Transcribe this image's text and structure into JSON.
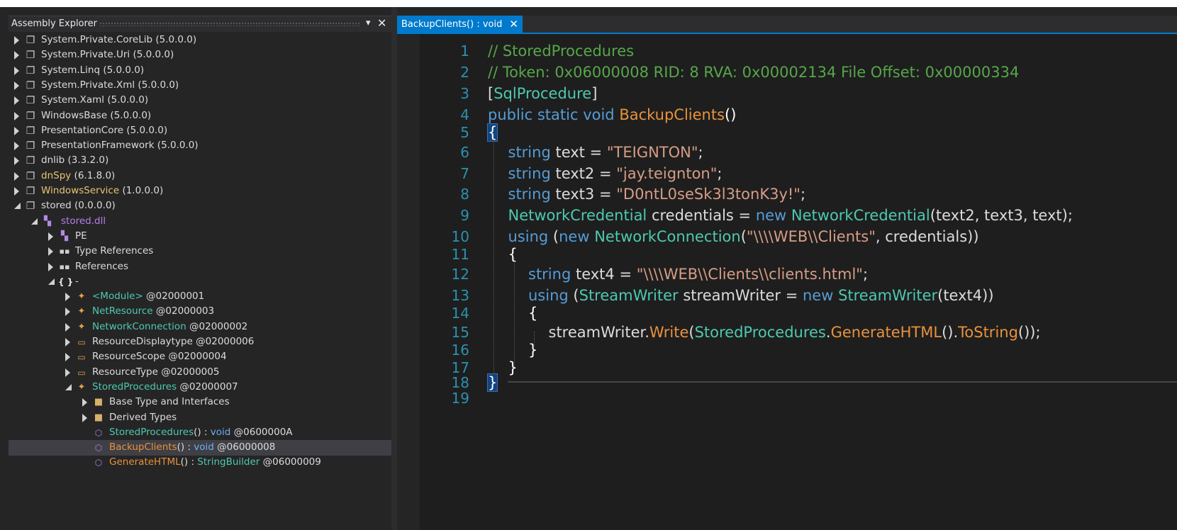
{
  "explorer": {
    "title": "Assembly Explorer",
    "pin_icon": "dropdown-arrow-icon",
    "close_icon": "close-icon",
    "pin_glyph": "▾",
    "close_glyph": "✕",
    "nodes": [
      {
        "parts": [
          {
            "t": "System.Private.CoreLib",
            "c": "white"
          },
          {
            "t": " (5.0.0.0)",
            "c": "white"
          }
        ],
        "icon": "assembly-icon",
        "state": "collapsed"
      },
      {
        "parts": [
          {
            "t": "System.Private.Uri",
            "c": "white"
          },
          {
            "t": " (5.0.0.0)",
            "c": "white"
          }
        ],
        "icon": "assembly-icon",
        "state": "collapsed"
      },
      {
        "parts": [
          {
            "t": "System.Linq",
            "c": "white"
          },
          {
            "t": " (5.0.0.0)",
            "c": "white"
          }
        ],
        "icon": "assembly-icon",
        "state": "collapsed"
      },
      {
        "parts": [
          {
            "t": "System.Private.Xml",
            "c": "white"
          },
          {
            "t": " (5.0.0.0)",
            "c": "white"
          }
        ],
        "icon": "assembly-icon",
        "state": "collapsed"
      },
      {
        "parts": [
          {
            "t": "System.Xaml",
            "c": "white"
          },
          {
            "t": " (5.0.0.0)",
            "c": "white"
          }
        ],
        "icon": "assembly-icon",
        "state": "collapsed"
      },
      {
        "parts": [
          {
            "t": "WindowsBase",
            "c": "white"
          },
          {
            "t": " (5.0.0.0)",
            "c": "white"
          }
        ],
        "icon": "assembly-icon",
        "state": "collapsed"
      },
      {
        "parts": [
          {
            "t": "PresentationCore",
            "c": "white"
          },
          {
            "t": " (5.0.0.0)",
            "c": "white"
          }
        ],
        "icon": "assembly-icon",
        "state": "collapsed"
      },
      {
        "parts": [
          {
            "t": "PresentationFramework",
            "c": "white"
          },
          {
            "t": " (5.0.0.0)",
            "c": "white"
          }
        ],
        "icon": "assembly-icon",
        "state": "collapsed"
      },
      {
        "parts": [
          {
            "t": "dnlib",
            "c": "white"
          },
          {
            "t": " (3.3.2.0)",
            "c": "white"
          }
        ],
        "icon": "assembly-icon",
        "state": "collapsed"
      },
      {
        "parts": [
          {
            "t": "dnSpy",
            "c": "yellow"
          },
          {
            "t": " (6.1.8.0)",
            "c": "white"
          }
        ],
        "icon": "assembly-icon-yellow",
        "state": "collapsed"
      },
      {
        "parts": [
          {
            "t": "WindowsService",
            "c": "yellow"
          },
          {
            "t": " (1.0.0.0)",
            "c": "white"
          }
        ],
        "icon": "assembly-icon-yellow",
        "state": "collapsed"
      },
      {
        "parts": [
          {
            "t": "stored",
            "c": "white"
          },
          {
            "t": " (0.0.0.0)",
            "c": "white"
          }
        ],
        "icon": "assembly-icon",
        "state": "expanded"
      },
      {
        "parts": [
          {
            "t": "stored.dll",
            "c": "purple"
          }
        ],
        "icon": "module-icon",
        "state": "expanded"
      },
      {
        "parts": [
          {
            "t": "PE",
            "c": "white"
          }
        ],
        "icon": "pe-icon",
        "state": "collapsed"
      },
      {
        "parts": [
          {
            "t": "Type References",
            "c": "white"
          }
        ],
        "icon": "references-icon",
        "state": "collapsed"
      },
      {
        "parts": [
          {
            "t": "References",
            "c": "white"
          }
        ],
        "icon": "references-icon",
        "state": "collapsed"
      },
      {
        "parts": [
          {
            "t": "-",
            "c": "white"
          }
        ],
        "icon": "namespace-icon",
        "state": "expanded"
      },
      {
        "parts": [
          {
            "t": "<Module>",
            "c": "teal"
          },
          {
            "t": " @02000001",
            "c": "white"
          }
        ],
        "icon": "class-icon",
        "state": "collapsed"
      },
      {
        "parts": [
          {
            "t": "NetResource",
            "c": "teal"
          },
          {
            "t": " @02000003",
            "c": "white"
          }
        ],
        "icon": "class-icon",
        "state": "collapsed"
      },
      {
        "parts": [
          {
            "t": "NetworkConnection",
            "c": "teal"
          },
          {
            "t": " @02000002",
            "c": "white"
          }
        ],
        "icon": "class-icon",
        "state": "collapsed"
      },
      {
        "parts": [
          {
            "t": "ResourceDisplaytype",
            "c": "white"
          },
          {
            "t": " @02000006",
            "c": "white"
          }
        ],
        "icon": "enum-icon",
        "state": "collapsed"
      },
      {
        "parts": [
          {
            "t": "ResourceScope",
            "c": "white"
          },
          {
            "t": " @02000004",
            "c": "white"
          }
        ],
        "icon": "enum-icon",
        "state": "collapsed"
      },
      {
        "parts": [
          {
            "t": "ResourceType",
            "c": "white"
          },
          {
            "t": " @02000005",
            "c": "white"
          }
        ],
        "icon": "enum-icon",
        "state": "collapsed"
      },
      {
        "parts": [
          {
            "t": "StoredProcedures",
            "c": "teal"
          },
          {
            "t": " @02000007",
            "c": "white"
          }
        ],
        "icon": "class-icon",
        "state": "expanded"
      },
      {
        "parts": [
          {
            "t": "Base Type and Interfaces",
            "c": "white"
          }
        ],
        "icon": "folder-icon",
        "state": "collapsed"
      },
      {
        "parts": [
          {
            "t": "Derived Types",
            "c": "white"
          }
        ],
        "icon": "folder-icon",
        "state": "collapsed"
      },
      {
        "parts": [
          {
            "t": "StoredProcedures",
            "c": "teal"
          },
          {
            "t": "() : ",
            "c": "white"
          },
          {
            "t": "void",
            "c": "blue"
          },
          {
            "t": " @0600000A",
            "c": "white"
          }
        ],
        "icon": "method-icon",
        "state": "none"
      },
      {
        "parts": [
          {
            "t": "BackupClients",
            "c": "orange"
          },
          {
            "t": "() : ",
            "c": "white"
          },
          {
            "t": "void",
            "c": "blue"
          },
          {
            "t": " @06000008",
            "c": "white"
          }
        ],
        "icon": "method-icon",
        "state": "none",
        "selected": true
      },
      {
        "parts": [
          {
            "t": "GenerateHTML",
            "c": "orange"
          },
          {
            "t": "() : ",
            "c": "white"
          },
          {
            "t": "StringBuilder",
            "c": "teal"
          },
          {
            "t": " @06000009",
            "c": "white"
          }
        ],
        "icon": "method-icon",
        "state": "none"
      }
    ]
  },
  "editor": {
    "tab_label": "BackupClients() : void",
    "tab_close_glyph": "✕",
    "lines": [
      {
        "n": "1",
        "tokens": [
          {
            "t": "// StoredProcedures",
            "c": "cm"
          }
        ]
      },
      {
        "n": "2",
        "tokens": [
          {
            "t": "// Token: 0x06000008 RID: 8 RVA: 0x00002134 File Offset: 0x00000334",
            "c": "cm"
          }
        ]
      },
      {
        "n": "3",
        "tokens": [
          {
            "t": "[",
            "c": "tx"
          },
          {
            "t": "SqlProcedure",
            "c": "ty"
          },
          {
            "t": "]",
            "c": "tx"
          }
        ]
      },
      {
        "n": "4",
        "tokens": [
          {
            "t": "public static void ",
            "c": "kw"
          },
          {
            "t": "BackupClients",
            "c": "fn"
          },
          {
            "t": "()",
            "c": "br"
          }
        ]
      },
      {
        "n": "5",
        "tokens": [
          {
            "t": "{",
            "c": "br"
          }
        ]
      },
      {
        "n": "6",
        "tokens": [
          {
            "t": "string ",
            "c": "kw"
          },
          {
            "t": "text = ",
            "c": "tx"
          },
          {
            "t": "\"TEIGNTON\"",
            "c": "st"
          },
          {
            "t": ";",
            "c": "tx"
          }
        ]
      },
      {
        "n": "7",
        "tokens": [
          {
            "t": "string ",
            "c": "kw"
          },
          {
            "t": "text2 = ",
            "c": "tx"
          },
          {
            "t": "\"jay.teignton\"",
            "c": "st"
          },
          {
            "t": ";",
            "c": "tx"
          }
        ]
      },
      {
        "n": "8",
        "tokens": [
          {
            "t": "string ",
            "c": "kw"
          },
          {
            "t": "text3 = ",
            "c": "tx"
          },
          {
            "t": "\"D0ntL0seSk3l3tonK3y!\"",
            "c": "st"
          },
          {
            "t": ";",
            "c": "tx"
          }
        ]
      },
      {
        "n": "9",
        "tokens": [
          {
            "t": "NetworkCredential ",
            "c": "ty"
          },
          {
            "t": "credentials = ",
            "c": "tx"
          },
          {
            "t": "new ",
            "c": "kw"
          },
          {
            "t": "NetworkCredential",
            "c": "ty"
          },
          {
            "t": "(text2, text3, text);",
            "c": "tx"
          }
        ]
      },
      {
        "n": "10",
        "tokens": [
          {
            "t": "using ",
            "c": "kw"
          },
          {
            "t": "(",
            "c": "tx"
          },
          {
            "t": "new ",
            "c": "kw"
          },
          {
            "t": "NetworkConnection",
            "c": "ty"
          },
          {
            "t": "(",
            "c": "tx"
          },
          {
            "t": "\"\\\\\\\\WEB\\\\Clients\"",
            "c": "st"
          },
          {
            "t": ", credentials))",
            "c": "tx"
          }
        ]
      },
      {
        "n": "11",
        "tokens": [
          {
            "t": "{",
            "c": "br"
          }
        ]
      },
      {
        "n": "12",
        "tokens": [
          {
            "t": "string ",
            "c": "kw"
          },
          {
            "t": "text4 = ",
            "c": "tx"
          },
          {
            "t": "\"\\\\\\\\WEB\\\\Clients\\\\clients.html\"",
            "c": "st"
          },
          {
            "t": ";",
            "c": "tx"
          }
        ]
      },
      {
        "n": "13",
        "tokens": [
          {
            "t": "using ",
            "c": "kw"
          },
          {
            "t": "(",
            "c": "tx"
          },
          {
            "t": "StreamWriter ",
            "c": "ty"
          },
          {
            "t": "streamWriter = ",
            "c": "tx"
          },
          {
            "t": "new ",
            "c": "kw"
          },
          {
            "t": "StreamWriter",
            "c": "ty"
          },
          {
            "t": "(text4))",
            "c": "tx"
          }
        ]
      },
      {
        "n": "14",
        "tokens": [
          {
            "t": "{",
            "c": "br"
          }
        ]
      },
      {
        "n": "15",
        "tokens": [
          {
            "t": "streamWriter.",
            "c": "tx"
          },
          {
            "t": "Write",
            "c": "fn"
          },
          {
            "t": "(",
            "c": "tx"
          },
          {
            "t": "StoredProcedures",
            "c": "ty"
          },
          {
            "t": ".",
            "c": "tx"
          },
          {
            "t": "GenerateHTML",
            "c": "fn"
          },
          {
            "t": "().",
            "c": "tx"
          },
          {
            "t": "ToString",
            "c": "fn"
          },
          {
            "t": "());",
            "c": "tx"
          }
        ]
      },
      {
        "n": "16",
        "tokens": [
          {
            "t": "}",
            "c": "br"
          }
        ]
      },
      {
        "n": "17",
        "tokens": [
          {
            "t": "}",
            "c": "br"
          }
        ]
      },
      {
        "n": "18",
        "tokens": [
          {
            "t": "}",
            "c": "br"
          }
        ]
      },
      {
        "n": "19",
        "tokens": []
      }
    ]
  }
}
